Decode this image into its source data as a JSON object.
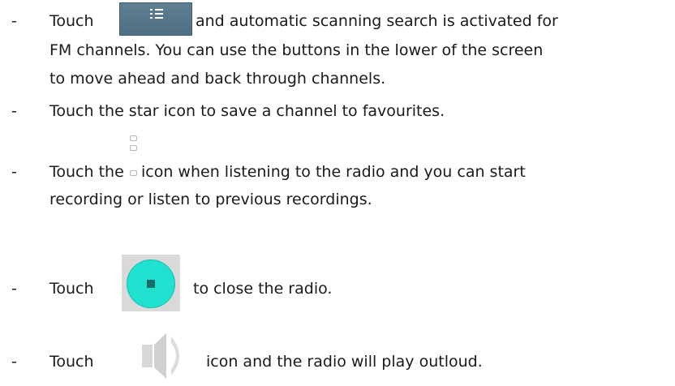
{
  "items": [
    {
      "dash": "-",
      "line1_before": "Touch",
      "line1_after": "and automatic scanning search is activated for",
      "line2": "FM channels. You can use the buttons in the lower of the screen",
      "line3": "to move ahead and back through channels."
    },
    {
      "dash": "-",
      "line1": "Touch the star icon to save a channel to favourites."
    },
    {
      "dash": "-",
      "line1_before": "Touch the",
      "line1_after": "icon when listening to the radio and you can start",
      "line2": "recording or listen to previous recordings."
    },
    {
      "dash": "-",
      "line1_before": "Touch",
      "line1_after": "to close the radio."
    },
    {
      "dash": "-",
      "line1_before": "Touch",
      "line1_after": "icon and the radio will play outloud."
    }
  ],
  "icons": {
    "list_button": "list-menu-icon",
    "record": "record-icon",
    "close_radio": "stop-circle-icon",
    "speaker": "speaker-icon"
  },
  "colors": {
    "list_button_bg": "#56778b",
    "close_circle": "#20e0cf",
    "close_tile_bg": "#d9d9d9",
    "speaker": "#d6d6d6"
  }
}
